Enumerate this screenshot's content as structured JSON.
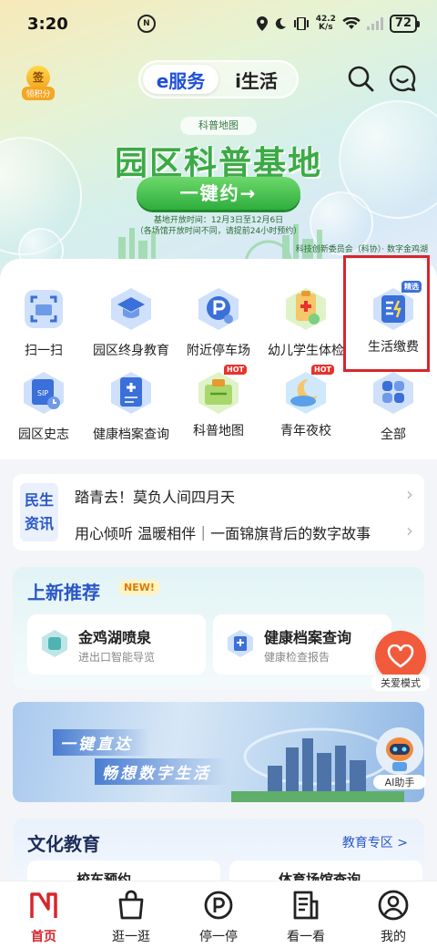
{
  "status_bar": {
    "time": "3:20",
    "nfc": "N",
    "net_speed_value": "42.2",
    "net_speed_unit": "K/s",
    "battery": "72"
  },
  "header": {
    "sign_in_glyph": "签",
    "sign_in_label": "领积分",
    "tabs": [
      {
        "label": "e服务",
        "active": true
      },
      {
        "label": "i生活",
        "active": false
      }
    ],
    "icons": [
      "search-icon",
      "message-icon"
    ]
  },
  "banner": {
    "tag": "科普地图",
    "title": "园区科普基地",
    "button": "一键约→",
    "sub_line1": "基地开放时间：12月3日至12月6日",
    "sub_line2": "（各场馆开放时间不同，请提前24小时预约）",
    "org": "科技创新委员会（科协）· 数字金鸡湖"
  },
  "services": [
    {
      "label": "扫一扫",
      "icon": "scan-icon",
      "hot": false
    },
    {
      "label": "园区终身教育",
      "icon": "graduation-cap-icon",
      "hot": false
    },
    {
      "label": "附近停车场",
      "icon": "parking-icon",
      "hot": false
    },
    {
      "label": "幼儿学生体检",
      "icon": "medical-clipboard-icon",
      "hot": false
    },
    {
      "label": "生活缴费",
      "icon": "bill-payment-icon",
      "hot": false,
      "badge": "精选"
    },
    {
      "label": "园区史志",
      "icon": "history-book-icon",
      "hot": false
    },
    {
      "label": "健康档案查询",
      "icon": "health-record-icon",
      "hot": false
    },
    {
      "label": "科普地图",
      "icon": "science-map-icon",
      "hot": true
    },
    {
      "label": "青年夜校",
      "icon": "night-school-icon",
      "hot": true
    },
    {
      "label": "全部",
      "icon": "grid-all-icon",
      "hot": false
    }
  ],
  "hot_label": "HOT",
  "news": {
    "tag_line1": "民生",
    "tag_line2": "资讯",
    "items": [
      "踏青去！莫负人间四月天",
      "用心倾听 温暖相伴｜一面锦旗背后的数字故事"
    ]
  },
  "recommend": {
    "title": "上新推荐",
    "new_badge": "NEW!",
    "cards": [
      {
        "title": "金鸡湖喷泉",
        "subtitle": "进出口智能导览"
      },
      {
        "title": "健康档案查询",
        "subtitle": "健康检查报告"
      }
    ]
  },
  "care_mode": {
    "label": "关爱模式"
  },
  "promo": {
    "line1": "一键直达",
    "line2": "畅想数字生活"
  },
  "ai_assistant": {
    "label": "AI助手"
  },
  "culture": {
    "title": "文化教育",
    "link": "教育专区 >",
    "cards": [
      "校车预约",
      "体育场馆查询"
    ]
  },
  "tabbar": [
    {
      "label": "首页",
      "active": true
    },
    {
      "label": "逛一逛",
      "active": false
    },
    {
      "label": "停一停",
      "active": false
    },
    {
      "label": "看一看",
      "active": false
    },
    {
      "label": "我的",
      "active": false
    }
  ],
  "colors": {
    "accent_red": "#d7262b",
    "brand_blue": "#1f4fd8",
    "banner_green": "#3caa46"
  }
}
